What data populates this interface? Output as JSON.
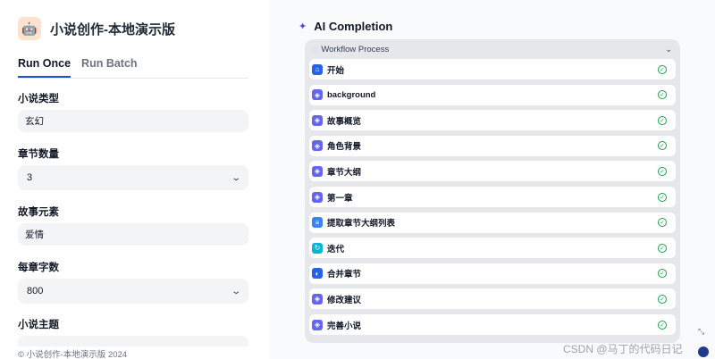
{
  "app": {
    "title": "小说创作-本地演示版",
    "icon": "robot-icon"
  },
  "tabs": [
    {
      "label": "Run Once",
      "active": true
    },
    {
      "label": "Run Batch",
      "active": false
    }
  ],
  "form": {
    "genre_label": "小说类型",
    "genre_value": "玄幻",
    "chapters_label": "章节数量",
    "chapters_value": "3",
    "elements_label": "故事元素",
    "elements_value": "爱情",
    "words_label": "每章字数",
    "words_value": "800",
    "theme_label": "小说主题",
    "theme_value": ""
  },
  "footer": "© 小说创作-本地演示版 2024",
  "completion": {
    "title": "AI Completion",
    "icon": "sparkle-icon"
  },
  "workflow": {
    "title": "Workflow Process",
    "nodes": [
      {
        "label": "开始",
        "icon": "home-icon",
        "color": "#2563eb",
        "status": "done"
      },
      {
        "label": "background",
        "icon": "llm-icon",
        "color": "#6366f1",
        "status": "done"
      },
      {
        "label": "故事概览",
        "icon": "llm-icon",
        "color": "#6366f1",
        "status": "done"
      },
      {
        "label": "角色背景",
        "icon": "llm-icon",
        "color": "#6366f1",
        "status": "done"
      },
      {
        "label": "章节大纲",
        "icon": "llm-icon",
        "color": "#6366f1",
        "status": "done"
      },
      {
        "label": "第一章",
        "icon": "llm-icon",
        "color": "#6366f1",
        "status": "done"
      },
      {
        "label": "提取章节大纲列表",
        "icon": "extract-icon",
        "color": "#3b82f6",
        "status": "done"
      },
      {
        "label": "迭代",
        "icon": "loop-icon",
        "color": "#06b6d4",
        "status": "done"
      },
      {
        "label": "合并章节",
        "icon": "merge-icon",
        "color": "#2563eb",
        "status": "done"
      },
      {
        "label": "修改建议",
        "icon": "llm-icon",
        "color": "#6366f1",
        "status": "done"
      },
      {
        "label": "完善小说",
        "icon": "llm-icon",
        "color": "#6366f1",
        "status": "done"
      }
    ]
  },
  "watermark": "CSDN @马丁的代码日记"
}
